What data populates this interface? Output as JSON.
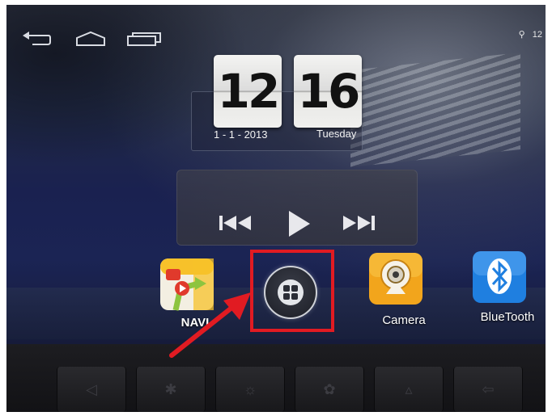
{
  "status_bar": {
    "nav_icons": [
      "back-icon",
      "home-icon",
      "recent-apps-icon"
    ],
    "status_icons": [
      "location-icon"
    ],
    "time_partial": "12"
  },
  "clock": {
    "hour": "12",
    "minute": "16",
    "date": "1 - 1 - 2013",
    "weekday": "Tuesday"
  },
  "media": {
    "controls": [
      "previous-icon",
      "play-icon",
      "next-icon"
    ]
  },
  "dock": {
    "apps": [
      {
        "label": "NAVI",
        "icon": "navi-map-icon"
      },
      {
        "label": "",
        "icon": "app-drawer-icon"
      },
      {
        "label": "Camera",
        "icon": "camera-icon"
      },
      {
        "label": "BlueTooth",
        "icon": "bluetooth-icon"
      }
    ]
  },
  "annotation": {
    "box_color": "#e11b22",
    "arrow_color": "#e11b22"
  },
  "hardware_keys": [
    "mute-icon",
    "bluetooth-key-icon",
    "light-key-icon",
    "fan-key-icon",
    "nav-key-icon",
    "back-key-icon"
  ]
}
